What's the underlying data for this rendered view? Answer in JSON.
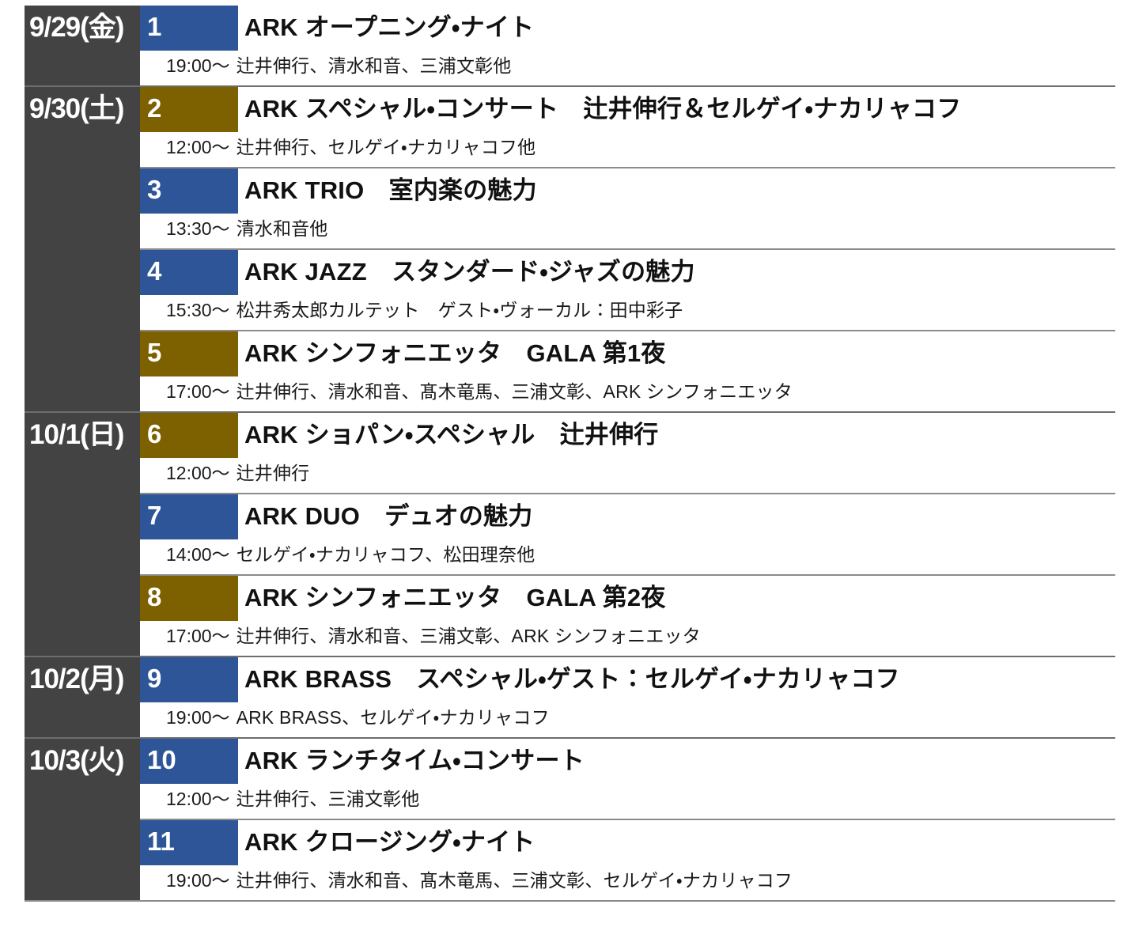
{
  "colors": {
    "date_bg": "#434343",
    "badge_blue": "#2e5597",
    "badge_gold": "#7d6000",
    "page_bg": "#ffffff",
    "text": "#111111",
    "border": "#8b8b8b"
  },
  "days": [
    {
      "date": "9/29(金)",
      "events": [
        {
          "number": "1",
          "badge_color": "blue",
          "title": "ARK オープニング・ナイト",
          "time": "19:00〜",
          "performers": "辻井伸行、清水和音、三浦文彰他"
        }
      ]
    },
    {
      "date": "9/30(土)",
      "events": [
        {
          "number": "2",
          "badge_color": "gold",
          "title": "ARK スペシャル・コンサート　辻井伸行＆セルゲイ・ナカリャコフ",
          "time": "12:00〜",
          "performers": "辻井伸行、セルゲイ・ナカリャコフ他"
        },
        {
          "number": "3",
          "badge_color": "blue",
          "title": "ARK TRIO　室内楽の魅力",
          "time": "13:30〜",
          "performers": "清水和音他"
        },
        {
          "number": "4",
          "badge_color": "blue",
          "title": "ARK JAZZ　スタンダード・ジャズの魅力",
          "time": "15:30〜",
          "performers": "松井秀太郎カルテット　ゲスト・ヴォーカル：田中彩子"
        },
        {
          "number": "5",
          "badge_color": "gold",
          "title": "ARK シンフォニエッタ　GALA 第1夜",
          "time": "17:00〜",
          "performers": "辻井伸行、清水和音、髙木竜馬、三浦文彰、ARK シンフォニエッタ"
        }
      ]
    },
    {
      "date": "10/1(日)",
      "events": [
        {
          "number": "6",
          "badge_color": "gold",
          "title": "ARK ショパン・スペシャル　辻井伸行",
          "time": "12:00〜",
          "performers": "辻井伸行"
        },
        {
          "number": "7",
          "badge_color": "blue",
          "title": "ARK DUO　デュオの魅力",
          "time": "14:00〜",
          "performers": "セルゲイ・ナカリャコフ、松田理奈他"
        },
        {
          "number": "8",
          "badge_color": "gold",
          "title": "ARK シンフォニエッタ　GALA 第2夜",
          "time": "17:00〜",
          "performers": "辻井伸行、清水和音、三浦文彰、ARK シンフォニエッタ"
        }
      ]
    },
    {
      "date": "10/2(月)",
      "events": [
        {
          "number": "9",
          "badge_color": "blue",
          "title": "ARK BRASS　スペシャル・ゲスト：セルゲイ・ナカリャコフ",
          "time": "19:00〜",
          "performers": "ARK BRASS、セルゲイ・ナカリャコフ"
        }
      ]
    },
    {
      "date": "10/3(火)",
      "events": [
        {
          "number": "10",
          "badge_color": "blue",
          "title": "ARK ランチタイム・コンサート",
          "time": "12:00〜",
          "performers": "辻井伸行、三浦文彰他"
        },
        {
          "number": "11",
          "badge_color": "blue",
          "title": "ARK クロージング・ナイト",
          "time": "19:00〜",
          "performers": "辻井伸行、清水和音、髙木竜馬、三浦文彰、セルゲイ・ナカリャコフ"
        }
      ]
    }
  ]
}
